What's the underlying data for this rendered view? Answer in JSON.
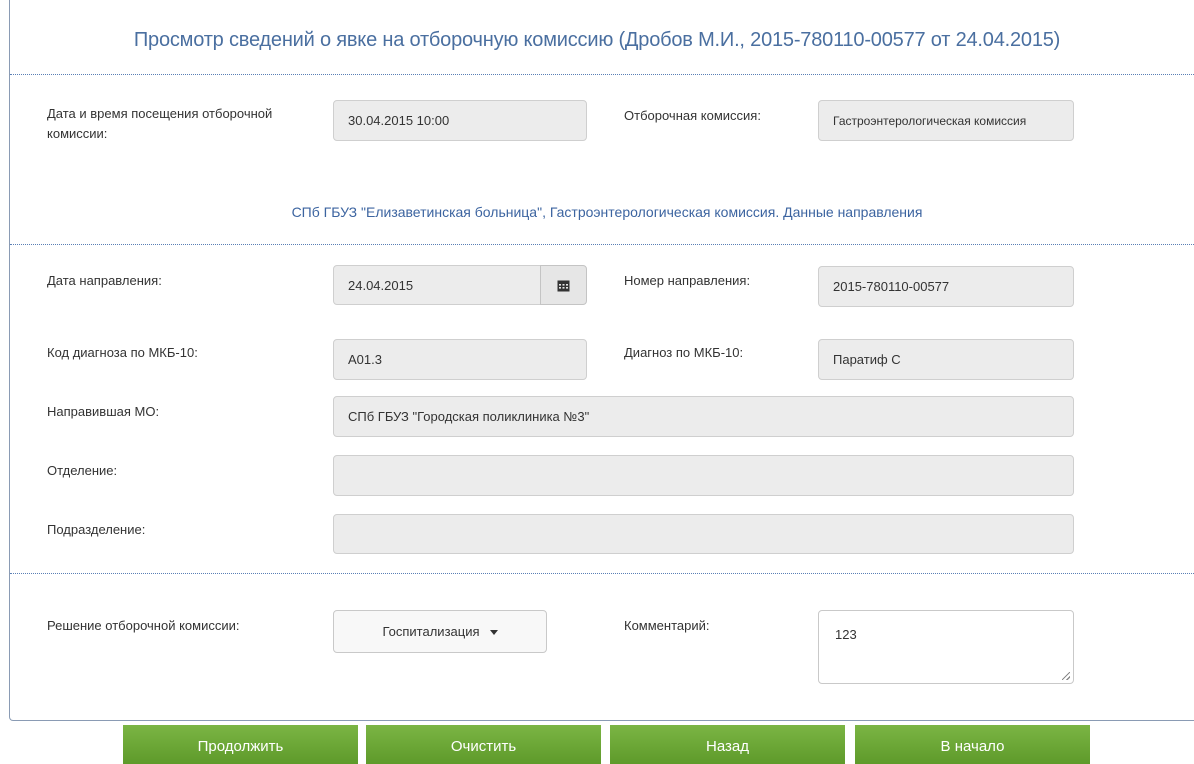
{
  "title": "Просмотр сведений о явке на отборочную комиссию (Дробов М.И., 2015-780110-00577 от 24.04.2015)",
  "visit": {
    "datetime_label": "Дата и время посещения отборочной комиссии:",
    "datetime_value": "30.04.2015 10:00",
    "commission_label": "Отборочная комиссия:",
    "commission_value": "Гастроэнтерологическая комиссия"
  },
  "referral_section": {
    "title": "СПб ГБУЗ \"Елизаветинская больница\", Гастроэнтерологическая комиссия. Данные направления",
    "date_label": "Дата направления:",
    "date_value": "24.04.2015",
    "number_label": "Номер направления:",
    "number_value": "2015-780110-00577",
    "icd_code_label": "Код диагноза по МКБ-10:",
    "icd_code_value": "A01.3",
    "diagnosis_label": "Диагноз по МКБ-10:",
    "diagnosis_value": "Паратиф С",
    "referring_mo_label": "Направившая МО:",
    "referring_mo_value": "СПб ГБУЗ \"Городская поликлиника №3\"",
    "department_label": "Отделение:",
    "department_value": "",
    "subdivision_label": "Подразделение:",
    "subdivision_value": ""
  },
  "decision": {
    "decision_label": "Решение отборочной комиссии:",
    "decision_value": "Госпитализация",
    "comment_label": "Комментарий:",
    "comment_value": "123"
  },
  "buttons": {
    "continue": "Продолжить",
    "clear": "Очистить",
    "back": "Назад",
    "home": "В начало"
  },
  "icons": {
    "calendar": "calendar-icon",
    "dropdown": "caret-down-icon",
    "resize": "resize-handle-icon"
  },
  "colors": {
    "title": "#4a6fa0",
    "button": "#6ba636",
    "field_bg": "#ececec"
  }
}
